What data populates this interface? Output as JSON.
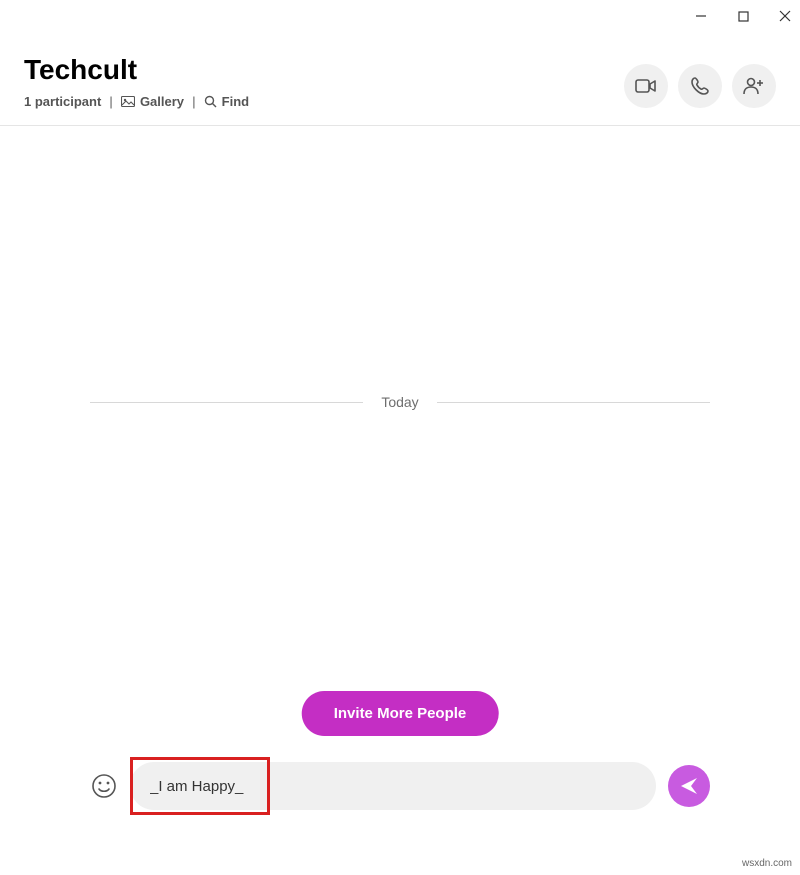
{
  "window": {
    "title": "Techcult"
  },
  "header": {
    "title": "Techcult",
    "participant_text": "1 participant",
    "gallery_label": "Gallery",
    "find_label": "Find"
  },
  "chat": {
    "date_label": "Today",
    "invite_button_label": "Invite More People"
  },
  "input": {
    "message_value": "_I am Happy_"
  },
  "watermark": "wsxdn.com",
  "colors": {
    "accent": "#c42ec4",
    "send": "#c85be0",
    "highlight": "#d92020"
  }
}
